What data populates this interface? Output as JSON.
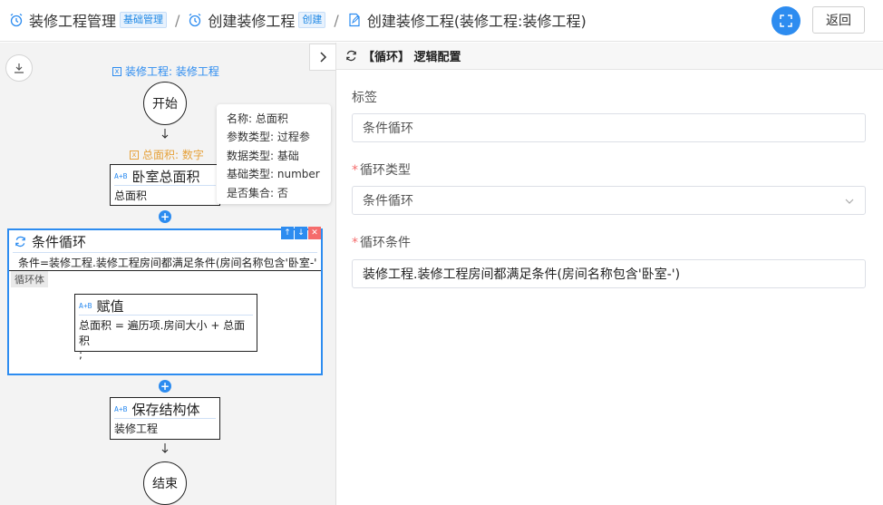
{
  "header": {
    "crumbs": [
      {
        "text": "装修工程管理",
        "tag": "基础管理"
      },
      {
        "text": "创建装修工程",
        "tag": "创建"
      },
      {
        "text": "创建装修工程(装修工程:装修工程)"
      }
    ],
    "separator": "/",
    "back_label": "返回"
  },
  "canvas": {
    "root_param": "装修工程: 装修工程",
    "start_label": "开始",
    "end_label": "结束",
    "var_param": "总面积: 数字",
    "nodes": [
      {
        "icon": "A+B",
        "title": "卧室总面积",
        "sub": "总面积"
      },
      {
        "icon": "A+B",
        "title": "赋值",
        "sub": "总面积 = 遍历项.房间大小 + 总面积",
        "sub2": ";"
      },
      {
        "icon": "A+B",
        "title": "保存结构体",
        "sub": "装修工程"
      }
    ],
    "loop": {
      "title": "条件循环",
      "condition": "条件=装修工程.装修工程房间都满足条件(房间名称包含'卧室-')",
      "body_label": "循环体"
    },
    "plus": "+",
    "tooltip": [
      "名称: 总面积",
      "参数类型: 过程参",
      "数据类型: 基础",
      "基础类型: number",
      "是否集合: 否"
    ]
  },
  "panel": {
    "title": "【循环】 逻辑配置",
    "fields": [
      {
        "label": "标签",
        "required": false,
        "value": "条件循环"
      },
      {
        "label": "循环类型",
        "required": true,
        "value": "条件循环"
      },
      {
        "label": "循环条件",
        "required": true,
        "value": "装修工程.装修工程房间都满足条件(房间名称包含'卧室-')"
      }
    ],
    "required_mark": "*"
  },
  "colors": {
    "accent": "#2d8cf0",
    "danger": "#f56c6c",
    "warning": "#e6a23c"
  }
}
